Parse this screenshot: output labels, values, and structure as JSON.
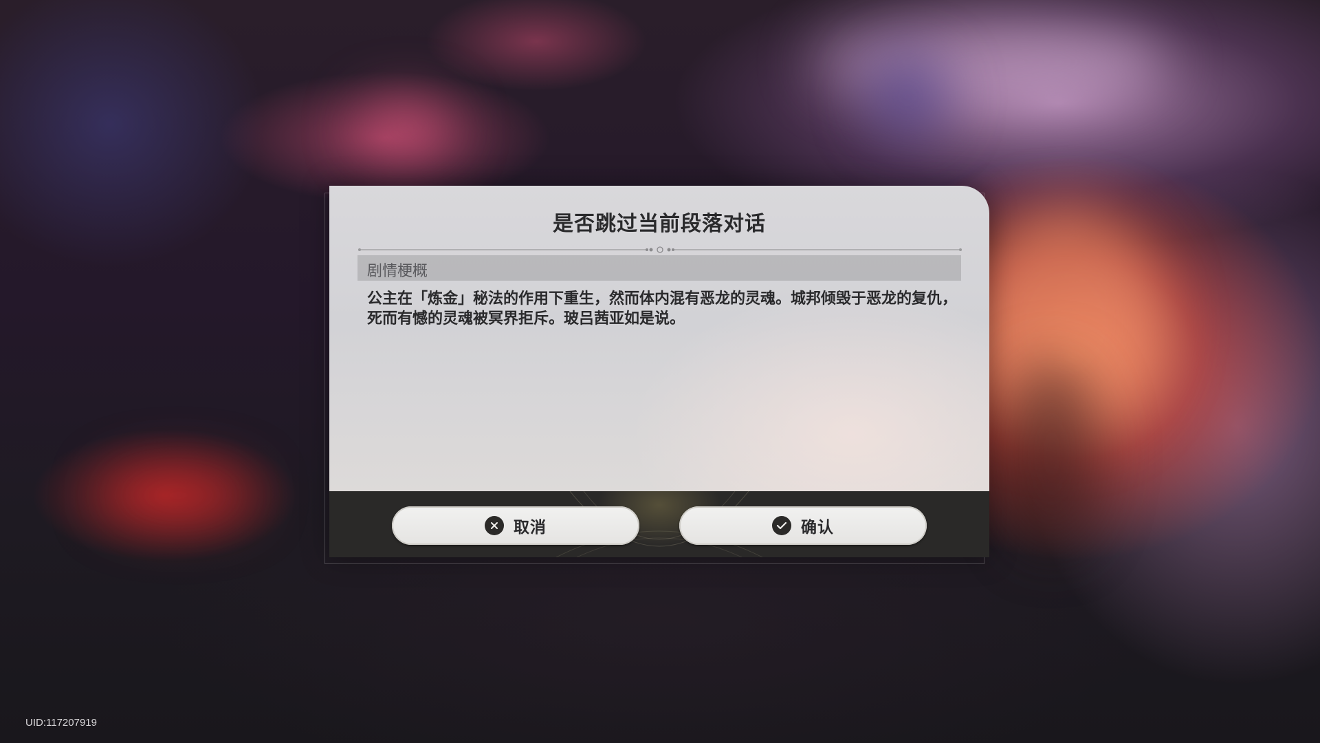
{
  "dialog": {
    "title": "是否跳过当前段落对话",
    "summary_label": "剧情梗概",
    "summary_text": "公主在「炼金」秘法的作用下重生，然而体内混有恶龙的灵魂。城邦倾毁于恶龙的复仇，死而有憾的灵魂被冥界拒斥。玻吕茜亚如是说。"
  },
  "buttons": {
    "cancel_label": "取消",
    "cancel_icon": "close-circle-icon",
    "confirm_label": "确认",
    "confirm_icon": "check-circle-icon"
  },
  "footer": {
    "uid": "UID:117207919"
  },
  "colors": {
    "panel": "#d6d5d8",
    "button_bar": "#2a2928",
    "text_dark": "#2a2a2c"
  }
}
